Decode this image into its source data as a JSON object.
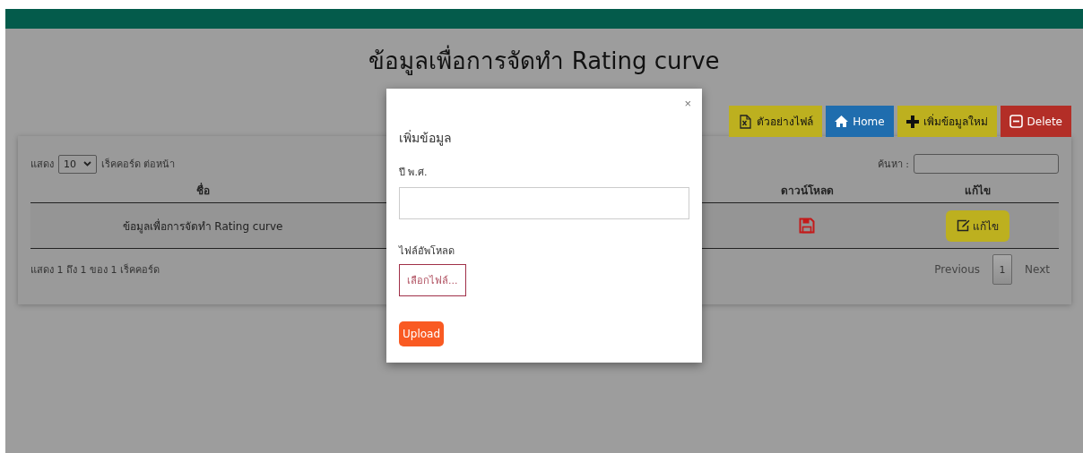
{
  "page_title": "ข้อมูลเพื่อการจัดทำ Rating curve",
  "toolbar_buttons": [
    {
      "kind": "sample",
      "label": "ตัวอย่างไฟล์"
    },
    {
      "kind": "home",
      "label": "Home"
    },
    {
      "kind": "add",
      "label": "เพิ่มข้อมูลใหม่"
    },
    {
      "kind": "delete",
      "label": "Delete"
    }
  ],
  "table_controls": {
    "show_label": "แสดง",
    "page_size": "10",
    "records_label": "เร็คคอร์ด ต่อหน้า",
    "search_label": "ค้นหา :"
  },
  "table": {
    "columns": [
      "ชื่อ",
      "ดาวน์โหลด",
      "แก้ไข"
    ],
    "rows": [
      {
        "name": "ข้อมูลเพื่อการจัดทำ Rating curve",
        "edit_label": "แก้ไข"
      }
    ]
  },
  "info": "แสดง 1 ถึง 1 ของ 1 เร็คคอร์ด",
  "pagination": {
    "previous": "Previous",
    "pages": [
      {
        "label": "1",
        "selected": true
      }
    ],
    "next": "Next"
  },
  "modal": {
    "close": "×",
    "title": "เพิ่มข้อมูล",
    "year_label": "ปี พ.ศ.",
    "file_label": "ไฟล์อัพโหลด",
    "file_button": "เลือกไฟล์...",
    "submit": "Upload"
  }
}
